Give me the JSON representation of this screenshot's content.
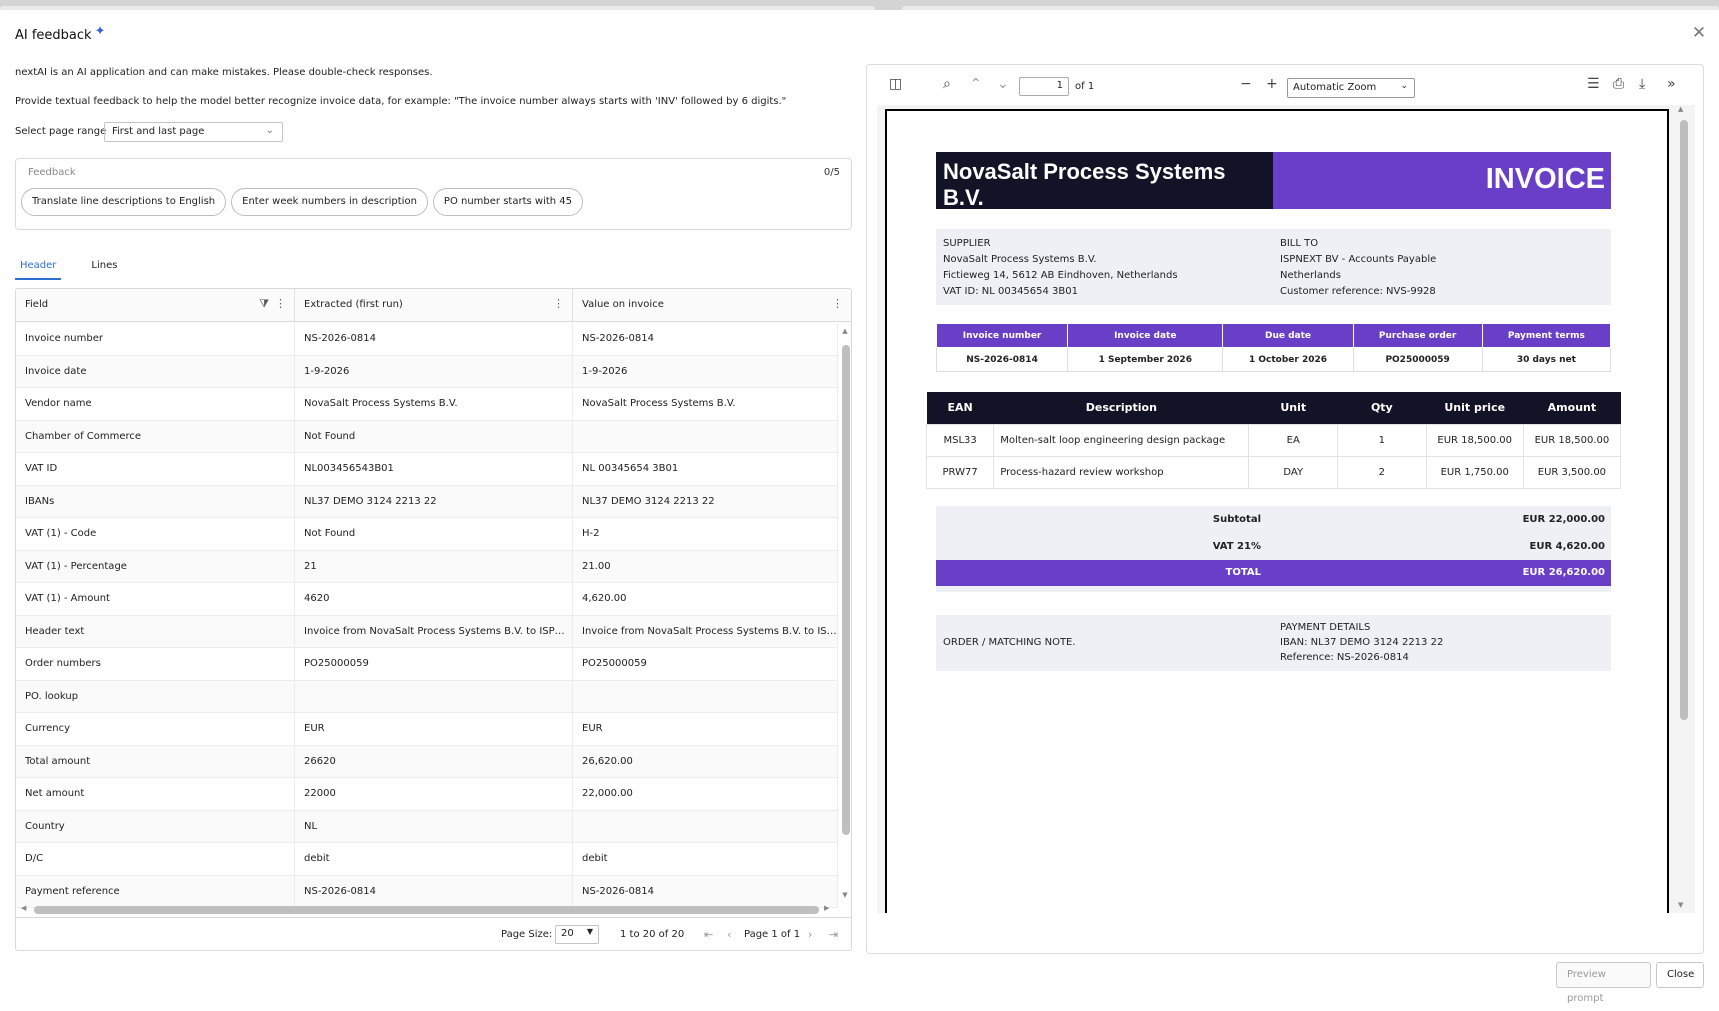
{
  "dialog": {
    "title": "AI feedback",
    "disclaimer": "nextAI is an AI application and can make mistakes. Please double-check responses.",
    "hint": "Provide textual feedback to help the model better recognize invoice data, for example: \"The invoice number always starts with 'INV' followed by 6 digits.\"",
    "page_range_label": "Select page range",
    "page_range_value": "First and last page"
  },
  "feedback": {
    "label": "Feedback",
    "count": "0/5",
    "chips": [
      "Translate line descriptions to English",
      "Enter week numbers in description",
      "PO number starts with 45"
    ]
  },
  "tabs": [
    {
      "label": "Header"
    },
    {
      "label": "Lines"
    }
  ],
  "grid": {
    "columns": [
      "Field",
      "Extracted (first run)",
      "Value on invoice"
    ],
    "rows": [
      {
        "field": "Invoice number",
        "extracted": "NS-2026-0814",
        "invoice": "NS-2026-0814"
      },
      {
        "field": "Invoice date",
        "extracted": "1-9-2026",
        "invoice": "1-9-2026"
      },
      {
        "field": "Vendor name",
        "extracted": "NovaSalt Process Systems B.V.",
        "invoice": "NovaSalt Process Systems B.V."
      },
      {
        "field": "Chamber of Commerce",
        "extracted": "Not Found",
        "invoice": ""
      },
      {
        "field": "VAT ID",
        "extracted": "NL003456543B01",
        "invoice": "NL 00345654 3B01"
      },
      {
        "field": "IBANs",
        "extracted": "NL37 DEMO 3124 2213 22",
        "invoice": "NL37 DEMO 3124 2213 22"
      },
      {
        "field": "VAT (1) - Code",
        "extracted": "Not Found",
        "invoice": "H-2"
      },
      {
        "field": "VAT (1) - Percentage",
        "extracted": "21",
        "invoice": "21.00"
      },
      {
        "field": "VAT (1) - Amount",
        "extracted": "4620",
        "invoice": "4,620.00"
      },
      {
        "field": "Header text",
        "extracted": "Invoice from NovaSalt Process Systems B.V. to ISPNE...",
        "invoice": "Invoice from NovaSalt Process Systems B.V. to ISPNE..."
      },
      {
        "field": "Order numbers",
        "extracted": "PO25000059",
        "invoice": "PO25000059"
      },
      {
        "field": "PO. lookup",
        "extracted": "",
        "invoice": ""
      },
      {
        "field": "Currency",
        "extracted": "EUR",
        "invoice": "EUR"
      },
      {
        "field": "Total amount",
        "extracted": "26620",
        "invoice": "26,620.00"
      },
      {
        "field": "Net amount",
        "extracted": "22000",
        "invoice": "22,000.00"
      },
      {
        "field": "Country",
        "extracted": "NL",
        "invoice": ""
      },
      {
        "field": "D/C",
        "extracted": "debit",
        "invoice": "debit"
      },
      {
        "field": "Payment reference",
        "extracted": "NS-2026-0814",
        "invoice": "NS-2026-0814"
      }
    ],
    "pager": {
      "page_size_label": "Page Size:",
      "page_size": "20",
      "range": "1 to 20 of 20",
      "page": "Page 1 of 1"
    }
  },
  "viewer": {
    "page_number": "1",
    "page_of": "of 1",
    "zoom": "Automatic Zoom"
  },
  "invoice": {
    "company": "NovaSalt Process Systems B.V.",
    "doc_title": "INVOICE",
    "supplier": {
      "label": "SUPPLIER",
      "name": "NovaSalt Process Systems B.V.",
      "address": "Fictieweg 14, 5612 AB Eindhoven, Netherlands",
      "vat": "VAT ID: NL 00345654 3B01"
    },
    "bill_to": {
      "label": "BILL TO",
      "name": "ISPNEXT BV - Accounts Payable",
      "country": "Netherlands",
      "ref": "Customer reference: NVS-9928"
    },
    "meta_headers": [
      "Invoice number",
      "Invoice date",
      "Due date",
      "Purchase order",
      "Payment terms"
    ],
    "meta_values": [
      "NS-2026-0814",
      "1 September 2026",
      "1 October 2026",
      "PO25000059",
      "30 days net"
    ],
    "line_headers": [
      "EAN",
      "Description",
      "Unit",
      "Qty",
      "Unit price",
      "Amount"
    ],
    "lines": [
      [
        "MSL33",
        "Molten-salt loop engineering design package",
        "EA",
        "1",
        "EUR 18,500.00",
        "EUR 18,500.00"
      ],
      [
        "PRW77",
        "Process-hazard review workshop",
        "DAY",
        "2",
        "EUR 1,750.00",
        "EUR 3,500.00"
      ]
    ],
    "subtotal_label": "Subtotal",
    "subtotal": "EUR 22,000.00",
    "vat_label": "VAT 21%",
    "vat": "EUR 4,620.00",
    "total_label": "TOTAL",
    "total": "EUR 26,620.00",
    "order_note": "ORDER / MATCHING NOTE.",
    "payment_label": "PAYMENT DETAILS",
    "iban": "IBAN: NL37 DEMO 3124 2213 22",
    "reference": "Reference: NS-2026-0814"
  },
  "footer": {
    "preview": "Preview prompt",
    "close": "Close"
  }
}
